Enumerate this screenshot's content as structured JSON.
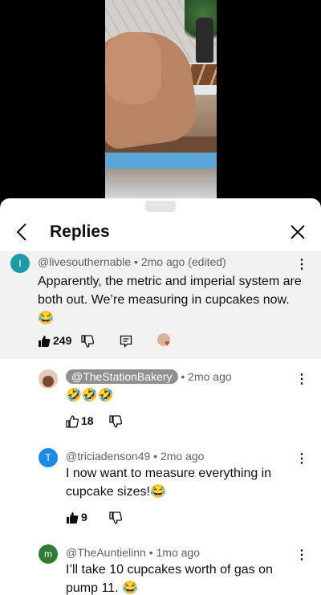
{
  "header": {
    "title": "Replies"
  },
  "parent_comment": {
    "avatar_letter": "l",
    "avatar_color": "#1f9aa8",
    "meta": "@livesouthernable • 2mo ago (edited)",
    "text": "Apparently, the metric and imperial system are both out. We’re measuring in cupcakes now. 😂",
    "likes": "249"
  },
  "replies": [
    {
      "handle": "@TheStationBakery",
      "time": "• 2mo ago",
      "text": "🤣🤣🤣",
      "likes": "18"
    },
    {
      "avatar_letter": "T",
      "avatar_color": "#1e88e5",
      "meta": "@triciadenson49 • 2mo ago",
      "text": "I now want to measure everything in cupcake sizes!😂",
      "likes": "9"
    },
    {
      "avatar_letter": "m",
      "avatar_color": "#2e7d32",
      "meta": "@TheAuntielinn • 1mo ago",
      "text": "I’ll take 10 cupcakes worth of gas on pump 11. 😂"
    }
  ]
}
